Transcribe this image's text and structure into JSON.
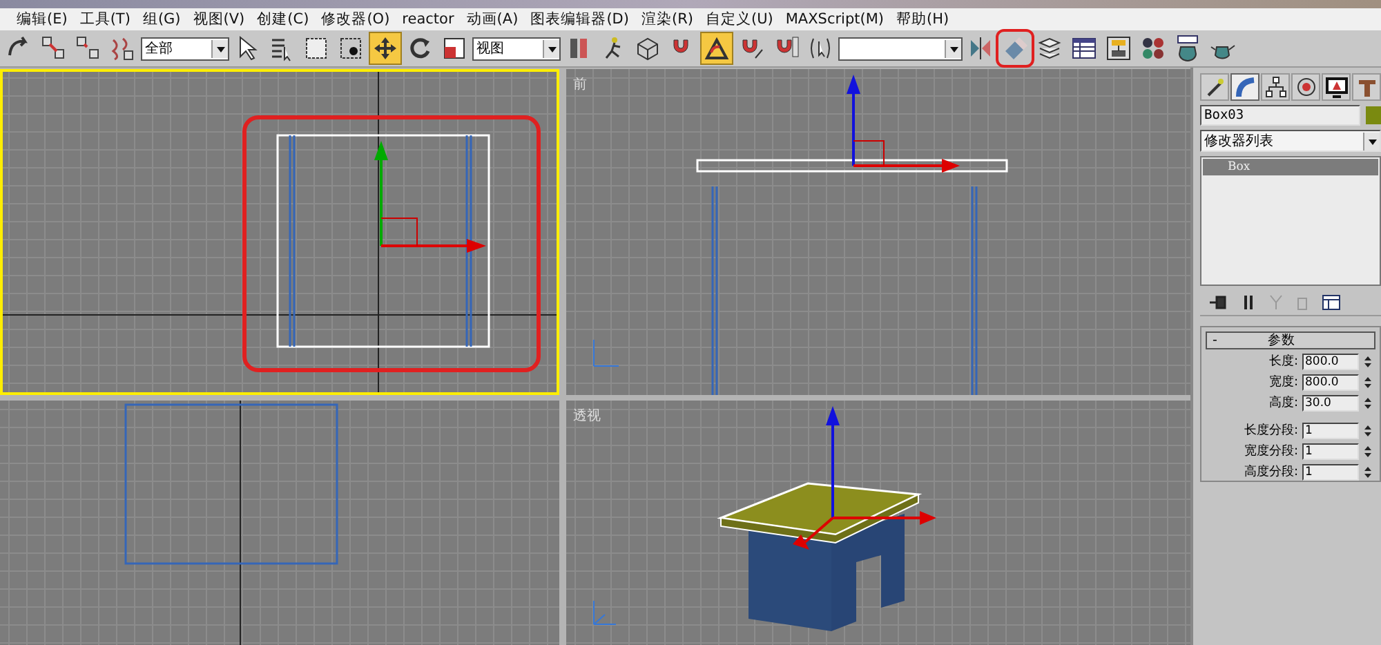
{
  "menu": [
    "编辑(E)",
    "工具(T)",
    "组(G)",
    "视图(V)",
    "创建(C)",
    "修改器(O)",
    "reactor",
    "动画(A)",
    "图表编辑器(D)",
    "渲染(R)",
    "自定义(U)",
    "MAXScript(M)",
    "帮助(H)"
  ],
  "toolbar": [
    {
      "kind": "curve-arrow",
      "selected": false
    },
    {
      "kind": "link",
      "selected": false
    },
    {
      "kind": "unlink",
      "selected": false
    },
    {
      "kind": "bind",
      "selected": false
    },
    {
      "kind": "dropdown",
      "value": "全部"
    },
    {
      "kind": "pointer",
      "selected": false
    },
    {
      "kind": "list",
      "selected": false
    },
    {
      "kind": "rect-select",
      "selected": false
    },
    {
      "kind": "window-select",
      "selected": false
    },
    {
      "kind": "move",
      "selected": true
    },
    {
      "kind": "rotate",
      "selected": false
    },
    {
      "kind": "scale",
      "selected": false
    },
    {
      "kind": "dropdown",
      "value": "视图"
    },
    {
      "kind": "pivot",
      "selected": false
    },
    {
      "kind": "manipulate",
      "selected": false
    },
    {
      "kind": "cube",
      "selected": false
    },
    {
      "kind": "magnet",
      "selected": false
    },
    {
      "kind": "angle-snap",
      "selected": true
    },
    {
      "kind": "percent-snap",
      "selected": false
    },
    {
      "kind": "spinner-snap",
      "selected": false
    },
    {
      "kind": "abc",
      "selected": false
    },
    {
      "kind": "dropdown"
    },
    {
      "kind": "mirror",
      "selected": false
    },
    {
      "kind": "align",
      "selected": false,
      "highlighted": true
    },
    {
      "kind": "layers",
      "selected": false
    },
    {
      "kind": "table",
      "selected": false
    },
    {
      "kind": "schematic",
      "selected": false
    },
    {
      "kind": "material",
      "selected": false
    },
    {
      "kind": "render-setup",
      "selected": false
    },
    {
      "kind": "teapot",
      "selected": false
    }
  ],
  "viewports": [
    {
      "kind": "top",
      "active": true
    },
    {
      "kind": "front",
      "label": "前",
      "active": false
    },
    {
      "kind": "left",
      "active": false
    },
    {
      "kind": "perspective",
      "label": "透视",
      "active": false
    }
  ],
  "command_panel": {
    "tabs": [
      {
        "kind": "create",
        "selected": false
      },
      {
        "kind": "modify",
        "selected": true
      },
      {
        "kind": "hierarchy",
        "selected": false
      },
      {
        "kind": "motion",
        "selected": false
      },
      {
        "kind": "display",
        "selected": false
      },
      {
        "kind": "utilities",
        "selected": false
      }
    ],
    "object_name": "Box03",
    "object_swatch": {
      "color": "#7a8a10"
    },
    "modifier_list": "修改器列表",
    "stack": [
      {
        "label": "Box",
        "selected": true
      }
    ],
    "rollout": {
      "toggle": "-",
      "title": "参数",
      "params": [
        {
          "label": "长度:",
          "value": "800.0"
        },
        {
          "label": "宽度:",
          "value": "800.0"
        },
        {
          "label": "高度:",
          "value": "30.0"
        },
        {
          "label": "长度分段:",
          "value": "1"
        },
        {
          "label": "宽度分段:",
          "value": "1"
        },
        {
          "label": "高度分段:",
          "value": "1"
        }
      ]
    }
  }
}
